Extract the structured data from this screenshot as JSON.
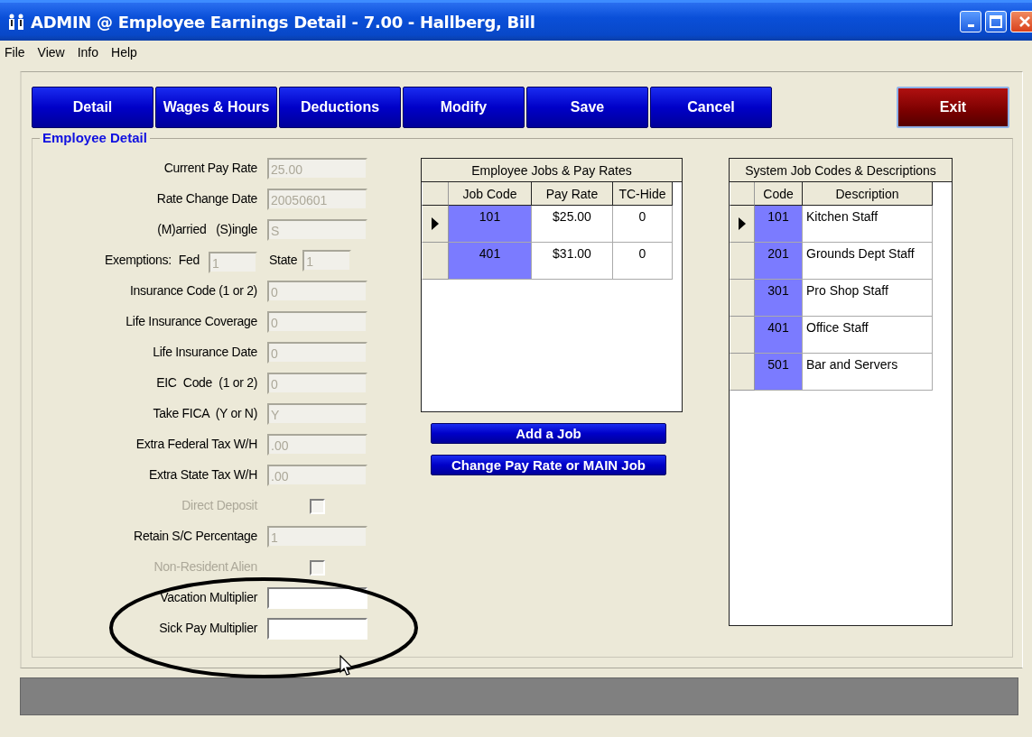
{
  "window": {
    "title": "ADMIN @ Employee Earnings Detail - 7.00 - Hallberg, Bill"
  },
  "menu": [
    "File",
    "View",
    "Info",
    "Help"
  ],
  "toolbar": [
    {
      "label": "Detail",
      "kind": "nav"
    },
    {
      "label": "Wages & Hours",
      "kind": "nav"
    },
    {
      "label": "Deductions",
      "kind": "nav"
    },
    {
      "label": "Modify",
      "kind": "nav"
    },
    {
      "label": "Save",
      "kind": "nav"
    },
    {
      "label": "Cancel",
      "kind": "nav"
    },
    {
      "label": "Exit",
      "kind": "exit"
    }
  ],
  "employee_detail": {
    "title": "Employee Detail",
    "fields": [
      {
        "kind": "text",
        "label": "Current Pay Rate",
        "value": "25.00",
        "disabled": true
      },
      {
        "kind": "text",
        "label": "Rate Change Date",
        "value": "20050601",
        "disabled": true
      },
      {
        "kind": "text",
        "label": "(M)arried   (S)ingle",
        "value": "S",
        "disabled": true
      },
      {
        "kind": "exemptions",
        "label": "Exemptions:",
        "fed_label": "Fed",
        "fed_value": "1",
        "state_label": "State",
        "state_value": "1",
        "disabled": true
      },
      {
        "kind": "text",
        "label": "Insurance Code (1 or 2)",
        "value": "0",
        "disabled": true
      },
      {
        "kind": "text",
        "label": "Life Insurance Coverage",
        "value": "0",
        "disabled": true
      },
      {
        "kind": "text",
        "label": "Life Insurance Date",
        "value": "0",
        "disabled": true
      },
      {
        "kind": "text",
        "label": "EIC  Code  (1 or 2)",
        "value": "0",
        "disabled": true
      },
      {
        "kind": "text",
        "label": "Take FICA  (Y or N)",
        "value": "Y",
        "disabled": true
      },
      {
        "kind": "text",
        "label": "Extra Federal Tax W/H",
        "value": ".00",
        "disabled": true
      },
      {
        "kind": "text",
        "label": "Extra State Tax W/H",
        "value": ".00",
        "disabled": true
      },
      {
        "kind": "checkbox",
        "label": "Direct Deposit",
        "checked": false,
        "disabled": true
      },
      {
        "kind": "text",
        "label": "Retain S/C Percentage",
        "value": "1",
        "disabled": true
      },
      {
        "kind": "checkbox",
        "label": "Non-Resident Alien",
        "checked": false,
        "disabled": true
      },
      {
        "kind": "text",
        "label": "Vacation Multiplier",
        "disabled": false
      },
      {
        "kind": "text",
        "label": "Sick Pay Multiplier",
        "disabled": false
      }
    ]
  },
  "jobs": {
    "title": "Employee Jobs & Pay Rates",
    "columns": [
      "Job Code",
      "Pay Rate",
      "TC-Hide"
    ],
    "rows": [
      {
        "selected": true,
        "cells": [
          "101",
          "$25.00",
          "0"
        ]
      },
      {
        "selected": false,
        "cells": [
          "401",
          "$31.00",
          "0"
        ]
      }
    ]
  },
  "actions": [
    "Add a Job",
    "Change Pay Rate or MAIN Job"
  ],
  "job_codes": {
    "title": "System Job Codes & Descriptions",
    "columns": [
      "Code",
      "Description"
    ],
    "rows": [
      {
        "selected": true,
        "cells": [
          "101",
          "Kitchen Staff"
        ]
      },
      {
        "selected": false,
        "cells": [
          "201",
          "Grounds Dept Staff"
        ]
      },
      {
        "selected": false,
        "cells": [
          "301",
          "Pro Shop Staff"
        ]
      },
      {
        "selected": false,
        "cells": [
          "401",
          "Office Staff"
        ]
      },
      {
        "selected": false,
        "cells": [
          "501",
          "Bar and Servers"
        ]
      }
    ]
  }
}
